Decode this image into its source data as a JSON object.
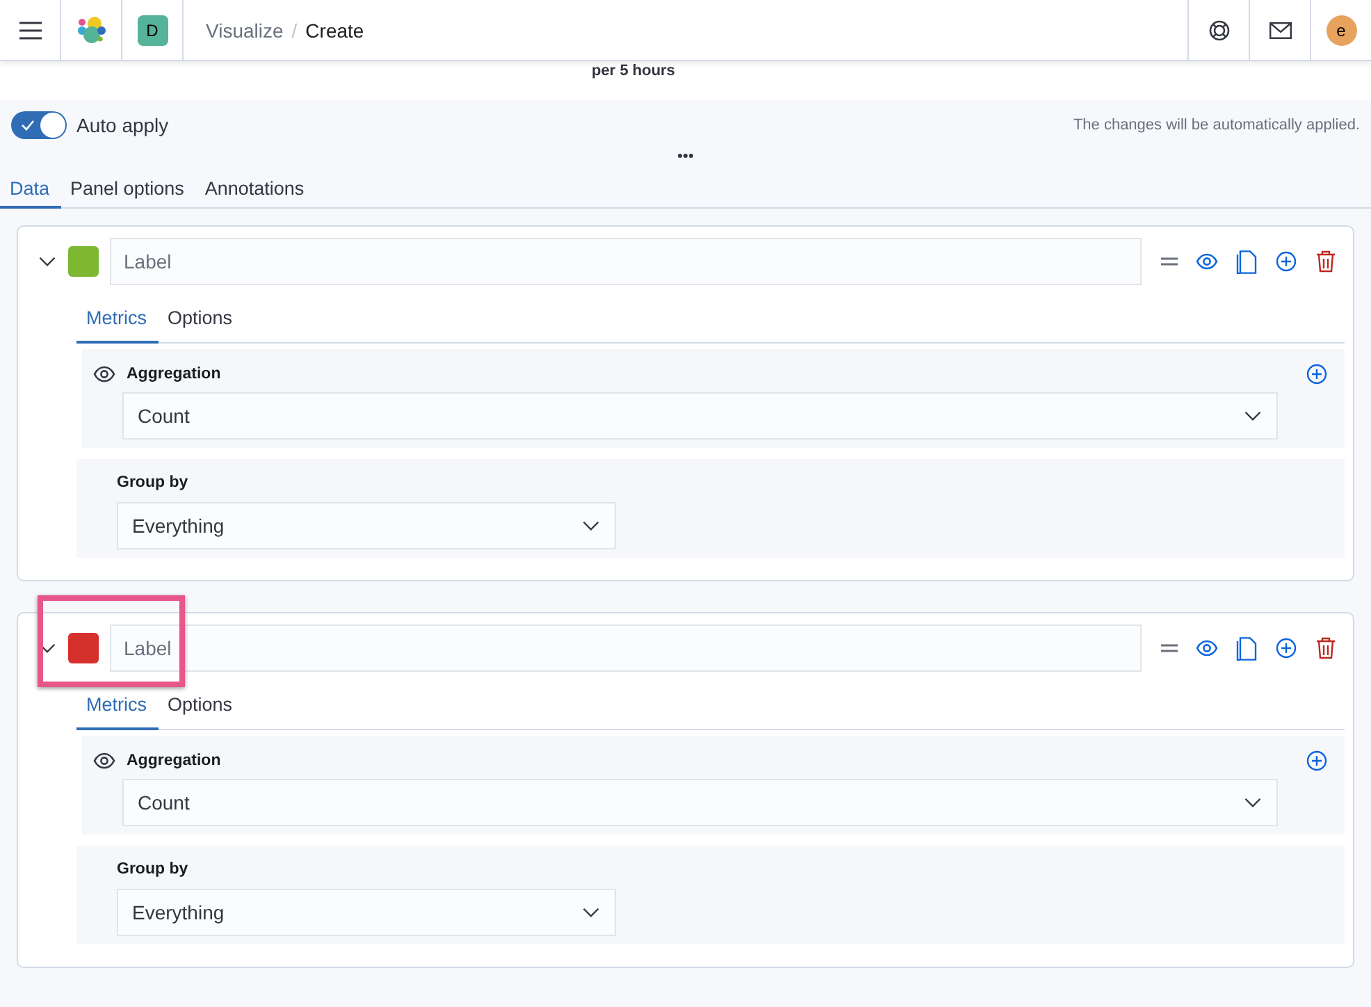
{
  "header": {
    "breadcrumbs": [
      {
        "label": "Visualize",
        "current": false
      },
      {
        "label": "/",
        "kind": "separator"
      },
      {
        "label": "Create",
        "current": true
      }
    ],
    "space_badge": "D",
    "avatar": "e"
  },
  "chart_caption": "per 5 hours",
  "auto_apply": {
    "label": "Auto apply",
    "on": true,
    "note": "The changes will be automatically applied."
  },
  "tabs": [
    {
      "label": "Data",
      "selected": true
    },
    {
      "label": "Panel options",
      "selected": false
    },
    {
      "label": "Annotations",
      "selected": false
    }
  ],
  "series": [
    {
      "color": "#7eb833",
      "expanded": true,
      "highlighted": false,
      "label_placeholder": "Label",
      "tabs": [
        {
          "label": "Metrics",
          "selected": true
        },
        {
          "label": "Options",
          "selected": false
        }
      ],
      "aggregation": {
        "label": "Aggregation",
        "value": "Count"
      },
      "group_by": {
        "label": "Group by",
        "value": "Everything"
      }
    },
    {
      "color": "#d6302c",
      "expanded": true,
      "highlighted": true,
      "label_placeholder": "Label",
      "tabs": [
        {
          "label": "Metrics",
          "selected": true
        },
        {
          "label": "Options",
          "selected": false
        }
      ],
      "aggregation": {
        "label": "Aggregation",
        "value": "Count"
      },
      "group_by": {
        "label": "Group by",
        "value": "Everything"
      }
    }
  ]
}
